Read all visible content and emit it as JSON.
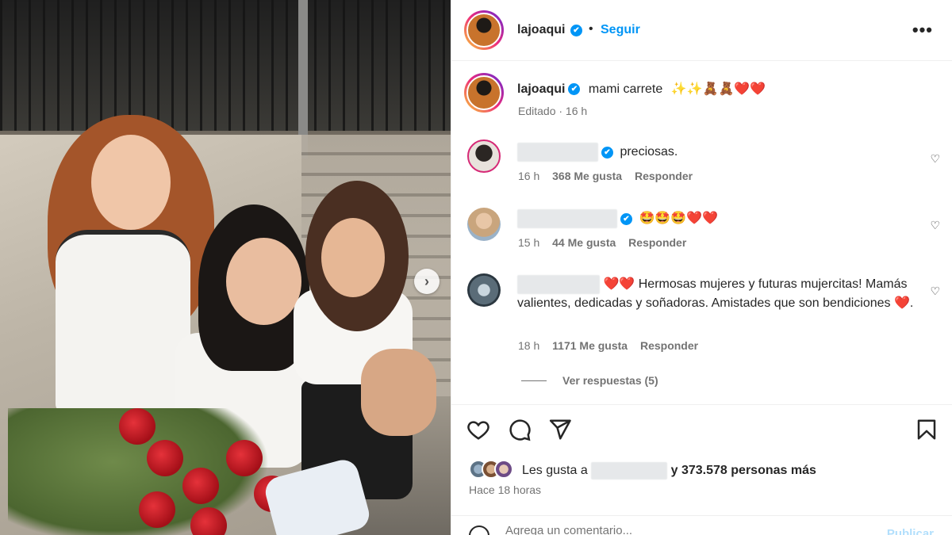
{
  "post_image": {
    "alt": ""
  },
  "header": {
    "username": "lajoaqui",
    "verified_mark": "✔",
    "separator": "•",
    "follow_label": "Seguir",
    "more_label": "•••"
  },
  "caption": {
    "username": "lajoaqui",
    "text": "mami carrete",
    "emojis": "✨✨🧸🧸❤️❤️",
    "meta": "Editado · 16 h"
  },
  "comments": [
    {
      "text": "preciosas.",
      "time": "16 h",
      "likes": "368 Me gusta",
      "reply": "Responder"
    },
    {
      "text": "🤩🤩🤩❤️❤️",
      "time": "15 h",
      "likes": "44 Me gusta",
      "reply": "Responder"
    },
    {
      "text": "❤️❤️ Hermosas mujeres y futuras mujercitas! Mamás valientes, dedicadas y soñadoras. Amistades que son bendiciones ❤️.",
      "time": "18 h",
      "likes": "1171 Me gusta",
      "reply": "Responder"
    }
  ],
  "view_replies": "Ver respuestas (5)",
  "likes_row": {
    "prefix": "Les gusta a",
    "suffix": "y 373.578 personas más"
  },
  "time_ago": "Hace 18 horas",
  "add_comment": {
    "placeholder": "Agrega un comentario...",
    "post_label": "Publicar"
  },
  "colors": {
    "accent": "#0095f6",
    "text": "#262626",
    "muted": "#737373",
    "heart": "#e0245e"
  }
}
